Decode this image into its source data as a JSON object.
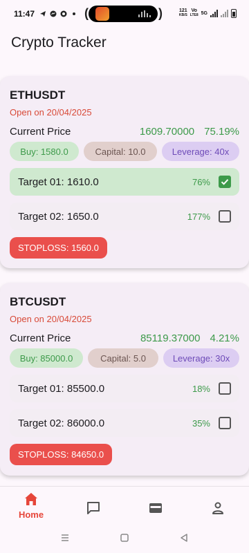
{
  "status_bar": {
    "time": "11:47",
    "net_speed": "121",
    "net_speed_unit": "KB/S",
    "volte": "Vo",
    "volte2": "LTE8",
    "network": "5G"
  },
  "app": {
    "title": "Crypto Tracker"
  },
  "cards": [
    {
      "symbol": "ETHUSDT",
      "open_text": "Open on 20/04/2025",
      "current_price_label": "Current Price",
      "current_price": "1609.70000",
      "change_pct": "75.19%",
      "buy": "Buy: 1580.0",
      "capital": "Capital: 10.0",
      "leverage": "Leverage: 40x",
      "targets": [
        {
          "label": "Target 01: 1610.0",
          "pct": "76%",
          "checked": true
        },
        {
          "label": "Target 02: 1650.0",
          "pct": "177%",
          "checked": false
        }
      ],
      "stoploss": "STOPLOSS: 1560.0"
    },
    {
      "symbol": "BTCUSDT",
      "open_text": "Open on 20/04/2025",
      "current_price_label": "Current Price",
      "current_price": "85119.37000",
      "change_pct": "4.21%",
      "buy": "Buy: 85000.0",
      "capital": "Capital: 5.0",
      "leverage": "Leverage: 30x",
      "targets": [
        {
          "label": "Target 01: 85500.0",
          "pct": "18%",
          "checked": false
        },
        {
          "label": "Target 02: 86000.0",
          "pct": "35%",
          "checked": false
        }
      ],
      "stoploss": "STOPLOSS: 84650.0"
    }
  ],
  "bottom_nav": {
    "items": [
      {
        "label": "Home",
        "icon": "home-icon",
        "active": true
      },
      {
        "label": "",
        "icon": "chat-icon",
        "active": false
      },
      {
        "label": "",
        "icon": "wallet-icon",
        "active": false
      },
      {
        "label": "",
        "icon": "profile-icon",
        "active": false
      }
    ]
  },
  "colors": {
    "accent": "#e6463a",
    "positive": "#3d9a4a",
    "stoploss": "#ea4f4c",
    "card_bg": "#f5edf6"
  }
}
